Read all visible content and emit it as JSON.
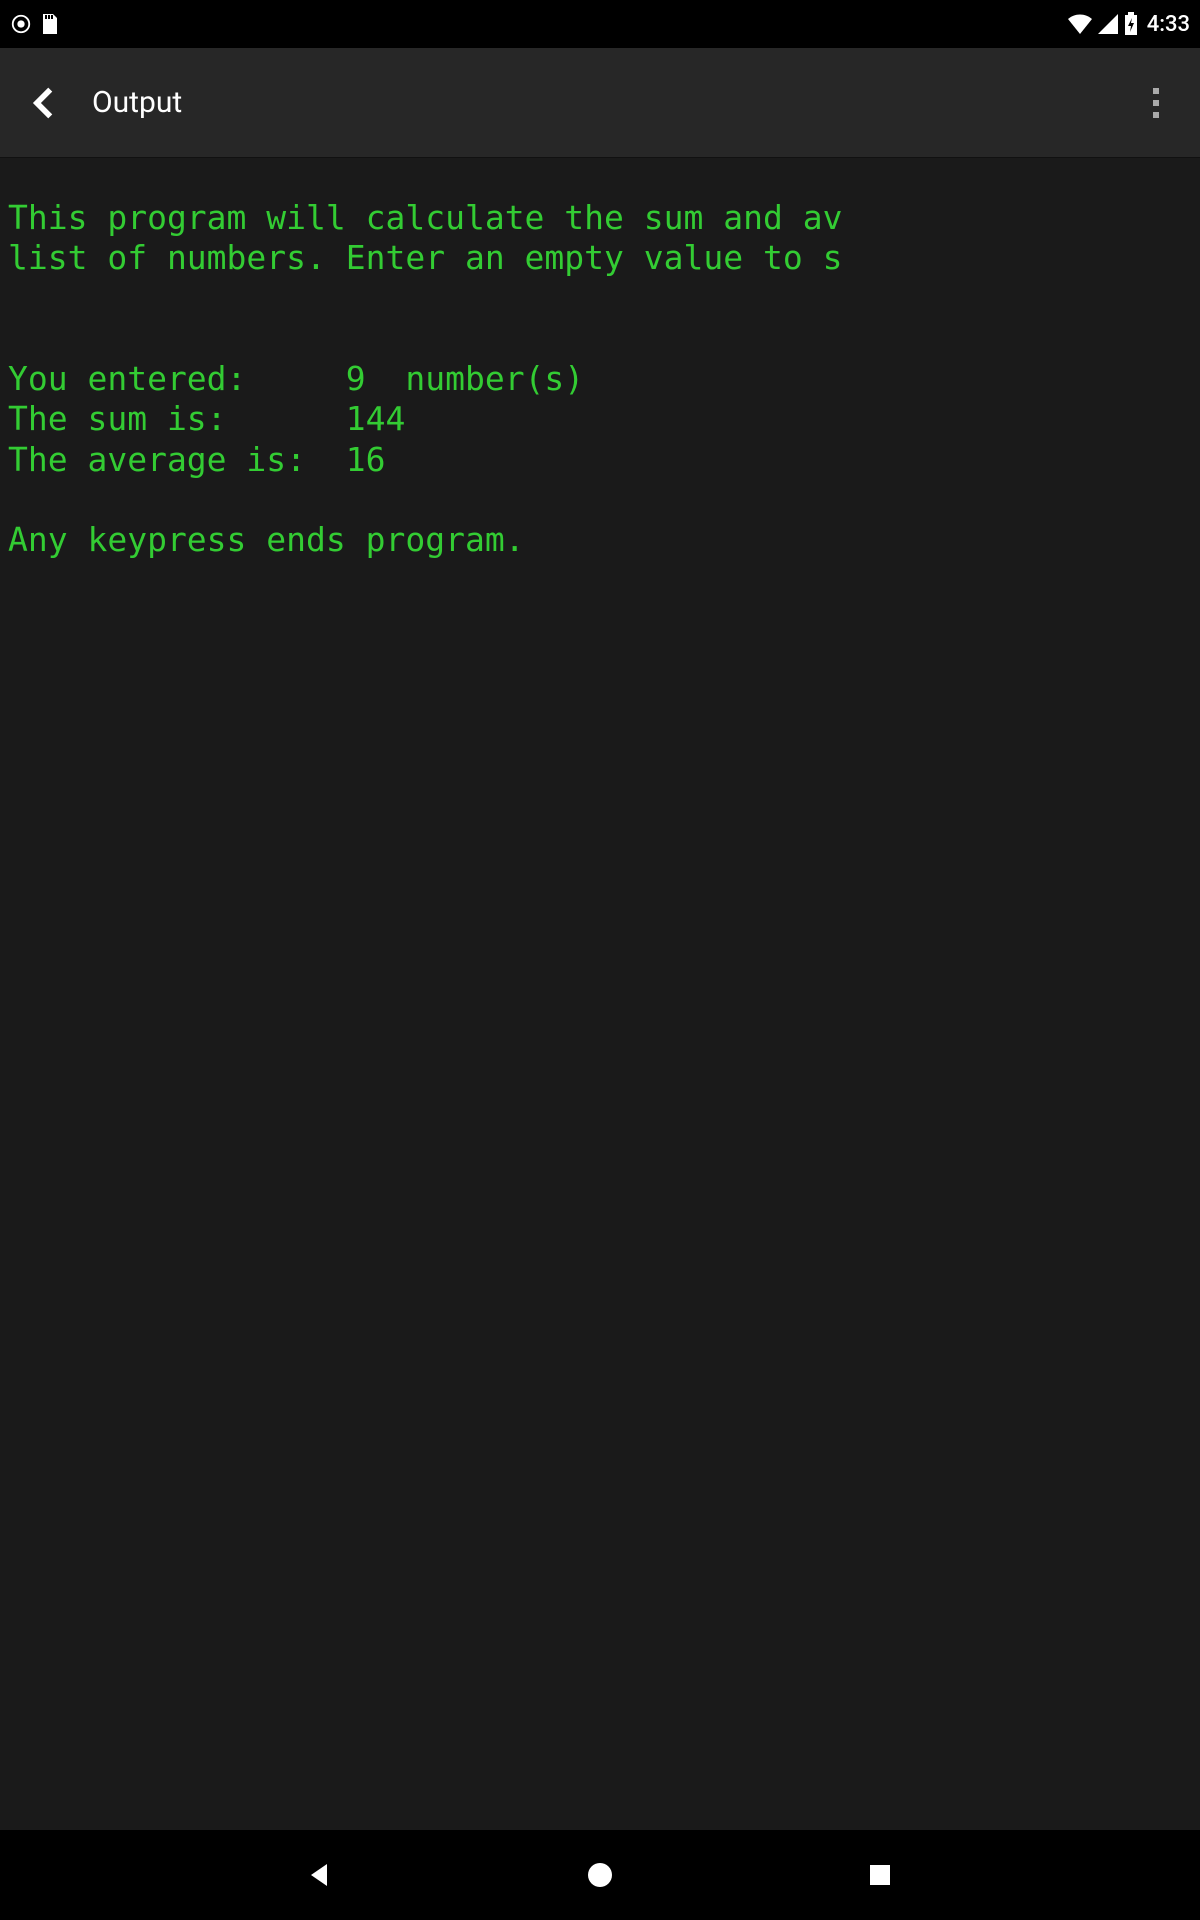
{
  "status_bar": {
    "clock": "4:33"
  },
  "app_bar": {
    "title": "Output"
  },
  "terminal": {
    "lines": {
      "intro1": "This program will calculate the sum and av",
      "intro2": "list of numbers. Enter an empty value to s",
      "entered": "You entered:     9  number(s)",
      "sum": "The sum is:      144",
      "avg": "The average is:  16",
      "footer": "Any keypress ends program."
    },
    "results": {
      "count": 9,
      "sum": 144,
      "average": 16
    }
  }
}
